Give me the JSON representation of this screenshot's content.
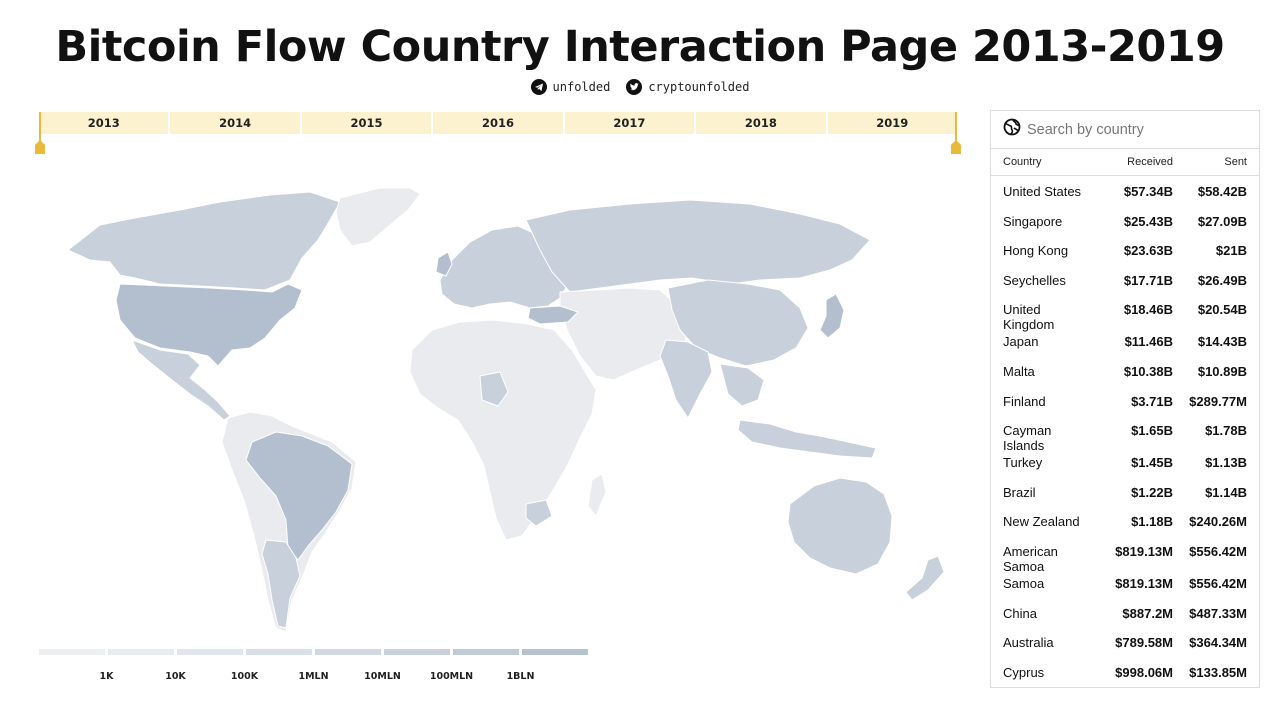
{
  "page": {
    "title": "Bitcoin Flow Country Interaction Page 2013-2019",
    "social": {
      "telegram_handle": "unfolded",
      "telegram_icon": "telegram-icon",
      "twitter_handle": "cryptounfolded",
      "twitter_icon": "twitter-icon"
    }
  },
  "timeline": {
    "years": [
      "2013",
      "2014",
      "2015",
      "2016",
      "2017",
      "2018",
      "2019"
    ],
    "range_start": "2013",
    "range_end": "2019",
    "accent_color": "#e9b93a",
    "band_color": "#fdf2cf"
  },
  "legend": {
    "labels": [
      "1K",
      "10K",
      "100K",
      "1MLN",
      "10MLN",
      "100MLN",
      "1BLN"
    ],
    "colors": [
      "#eeeff1",
      "#e8ebef",
      "#e1e6ec",
      "#d9dfe7",
      "#d1d8e1",
      "#c9d1dc",
      "#c1cad7",
      "#b7c2d0"
    ]
  },
  "map": {
    "land_light": "#e9ebef",
    "land_mid": "#c8d0db",
    "land_dark": "#b3bfce",
    "border": "#ffffff"
  },
  "panel": {
    "search_placeholder": "Search by country",
    "search_icon": "globe-icon",
    "headers": {
      "country": "Country",
      "received": "Received",
      "sent": "Sent"
    },
    "rows": [
      {
        "country": "United States",
        "received": "$57.34B",
        "sent": "$58.42B"
      },
      {
        "country": "Singapore",
        "received": "$25.43B",
        "sent": "$27.09B"
      },
      {
        "country": "Hong Kong",
        "received": "$23.63B",
        "sent": "$21B"
      },
      {
        "country": "Seychelles",
        "received": "$17.71B",
        "sent": "$26.49B"
      },
      {
        "country": "United Kingdom",
        "received": "$18.46B",
        "sent": "$20.54B"
      },
      {
        "country": "Japan",
        "received": "$11.46B",
        "sent": "$14.43B"
      },
      {
        "country": "Malta",
        "received": "$10.38B",
        "sent": "$10.89B"
      },
      {
        "country": "Finland",
        "received": "$3.71B",
        "sent": "$289.77M"
      },
      {
        "country": "Cayman Islands",
        "received": "$1.65B",
        "sent": "$1.78B"
      },
      {
        "country": "Turkey",
        "received": "$1.45B",
        "sent": "$1.13B"
      },
      {
        "country": "Brazil",
        "received": "$1.22B",
        "sent": "$1.14B"
      },
      {
        "country": "New Zealand",
        "received": "$1.18B",
        "sent": "$240.26M"
      },
      {
        "country": "American Samoa",
        "received": "$819.13M",
        "sent": "$556.42M"
      },
      {
        "country": "Samoa",
        "received": "$819.13M",
        "sent": "$556.42M"
      },
      {
        "country": "China",
        "received": "$887.2M",
        "sent": "$487.33M"
      },
      {
        "country": "Australia",
        "received": "$789.58M",
        "sent": "$364.34M"
      },
      {
        "country": "Cyprus",
        "received": "$998.06M",
        "sent": "$133.85M"
      }
    ]
  }
}
